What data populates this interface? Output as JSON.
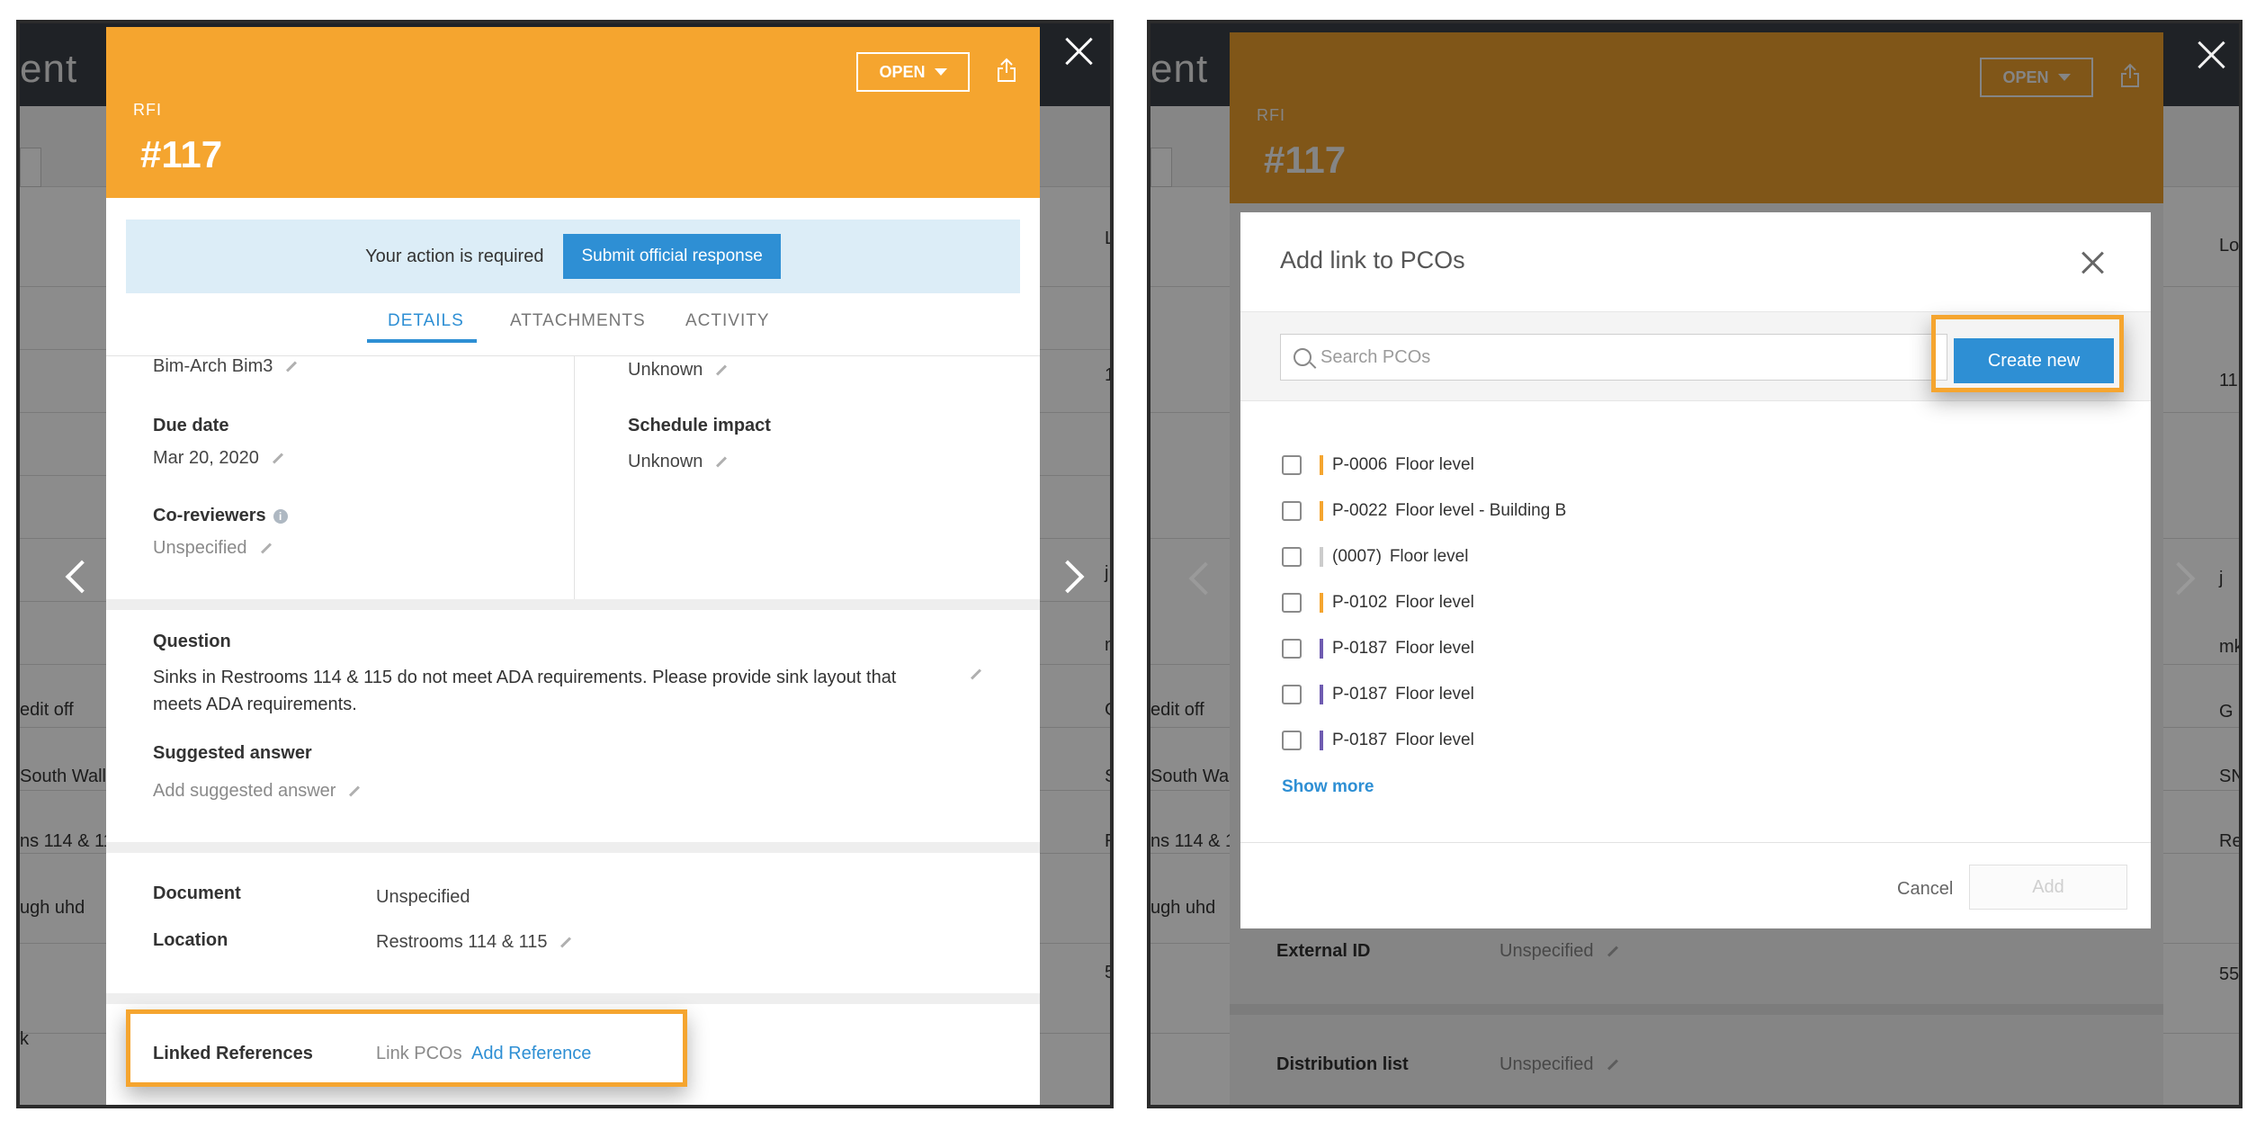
{
  "background": {
    "title_fragment": "ent",
    "left_cells": [
      "edit off",
      "South Wall",
      "ns 114 & 11",
      "ugh uhd",
      "k"
    ],
    "right_edge_cells_left": [
      "L",
      "1",
      "j",
      "m",
      "G",
      "S",
      "R",
      "5"
    ],
    "right_edge_cells_right": [
      "Lo",
      "11",
      "j",
      "mk",
      "G",
      "SN",
      "Re",
      "55"
    ]
  },
  "rfi": {
    "type_label": "RFI",
    "number": "#117",
    "status": "OPEN",
    "action_text": "Your action is required",
    "action_button": "Submit official response",
    "tabs": [
      "DETAILS",
      "ATTACHMENTS",
      "ACTIVITY"
    ],
    "fields": {
      "assignee": "Bim-Arch Bim3",
      "cost_impact": "Unknown",
      "due_date_label": "Due date",
      "due_date": "Mar 20, 2020",
      "schedule_impact_label": "Schedule impact",
      "schedule_impact": "Unknown",
      "coreviewers_label": "Co-reviewers",
      "coreviewers": "Unspecified",
      "question_label": "Question",
      "question": "Sinks in Restrooms 114 & 115 do not meet ADA requirements. Please provide sink layout that meets ADA requirements.",
      "suggested_answer_label": "Suggested answer",
      "suggested_answer": "Add suggested answer",
      "document_label": "Document",
      "document": "Unspecified",
      "location_label": "Location",
      "location": "Restrooms 114 & 115",
      "linked_refs_label": "Linked References",
      "link_pcos": "Link PCOs",
      "add_reference": "Add Reference"
    },
    "behind_modal": {
      "external_id_label": "External ID",
      "external_id": "Unspecified",
      "distribution_label": "Distribution list",
      "distribution": "Unspecified"
    }
  },
  "modal": {
    "title": "Add link to PCOs",
    "search_placeholder": "Search PCOs",
    "create_button": "Create new",
    "items": [
      {
        "id": "P-0006",
        "name": "Floor level",
        "color": "#f5a52f"
      },
      {
        "id": "P-0022",
        "name": "Floor level - Building B",
        "color": "#f5a52f"
      },
      {
        "id": "(0007)",
        "name": "Floor level",
        "color": "#cccccc"
      },
      {
        "id": "P-0102",
        "name": "Floor level",
        "color": "#f5a52f"
      },
      {
        "id": "P-0187",
        "name": "Floor level",
        "color": "#6e5bb0"
      },
      {
        "id": "P-0187",
        "name": "Floor level",
        "color": "#6e5bb0"
      },
      {
        "id": "P-0187",
        "name": "Floor level",
        "color": "#6e5bb0"
      }
    ],
    "show_more": "Show more",
    "cancel": "Cancel",
    "add": "Add"
  },
  "colors": {
    "accent_orange": "#f5a52f",
    "primary_blue": "#2e8fd4"
  }
}
